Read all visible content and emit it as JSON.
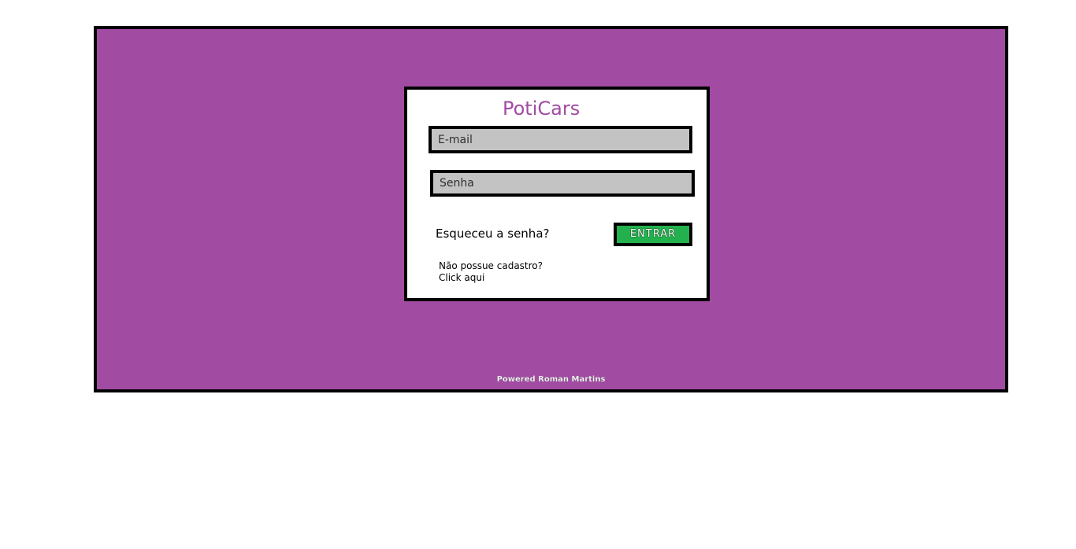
{
  "colors": {
    "background": "#a24ba3",
    "card": "#ffffff",
    "border": "#000000",
    "field": "#c3c3c3",
    "brand": "#a24ba3",
    "button": "#22b14c"
  },
  "login": {
    "title": "PotiCars",
    "email_placeholder": "E-mail",
    "password_placeholder": "Senha",
    "forgot_label": "Esqueceu a senha?",
    "enter_label": "ENTRAR",
    "signup_question": "Não possue cadastro?",
    "signup_link": "Click aqui"
  },
  "footer": {
    "credit": "Powered Roman Martins"
  }
}
